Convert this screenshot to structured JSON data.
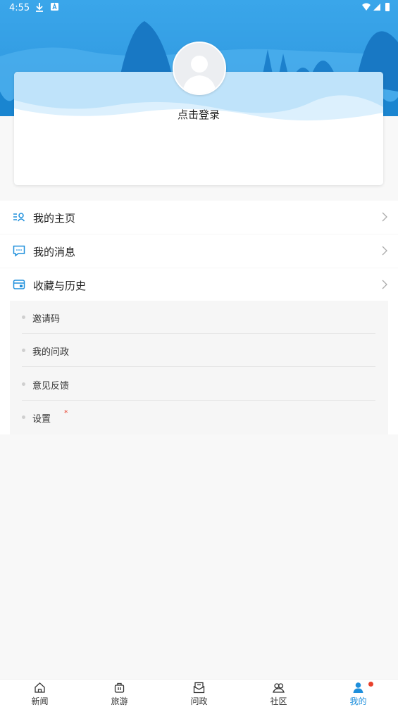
{
  "status_bar": {
    "time": "4:55"
  },
  "login": {
    "text": "点击登录"
  },
  "menu": [
    {
      "label": "我的主页",
      "icon": "profile-list-icon"
    },
    {
      "label": "我的消息",
      "icon": "message-icon"
    },
    {
      "label": "收藏与历史",
      "icon": "favorites-icon"
    }
  ],
  "submenu": [
    {
      "label": "邀请码"
    },
    {
      "label": "我的问政"
    },
    {
      "label": "意见反馈"
    },
    {
      "label": "设置",
      "badge": "*"
    }
  ],
  "tabs": [
    {
      "label": "新闻",
      "icon": "home-icon"
    },
    {
      "label": "旅游",
      "icon": "luggage-icon"
    },
    {
      "label": "问政",
      "icon": "mail-icon"
    },
    {
      "label": "社区",
      "icon": "community-icon"
    },
    {
      "label": "我的",
      "icon": "user-icon",
      "active": true
    }
  ],
  "colors": {
    "accent": "#1e8fdc",
    "header_blue": "#2f9be4",
    "badge_red": "#e8412c"
  }
}
